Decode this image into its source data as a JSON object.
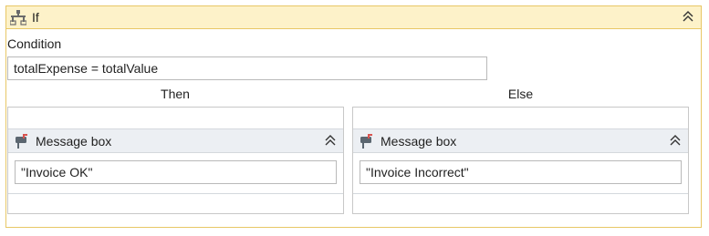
{
  "if_activity": {
    "title": "If",
    "icon": "if-activity-icon",
    "condition_label": "Condition",
    "condition_value": "totalExpense = totalValue",
    "accent_border": "#e8c766",
    "header_bg": "#fdf2c9"
  },
  "branches": {
    "then": {
      "label": "Then",
      "activity": {
        "title": "Message box",
        "icon": "message-box-icon",
        "text_value": "\"Invoice OK\""
      }
    },
    "else": {
      "label": "Else",
      "activity": {
        "title": "Message box",
        "icon": "message-box-icon",
        "text_value": "\"Invoice Incorrect\""
      }
    }
  }
}
